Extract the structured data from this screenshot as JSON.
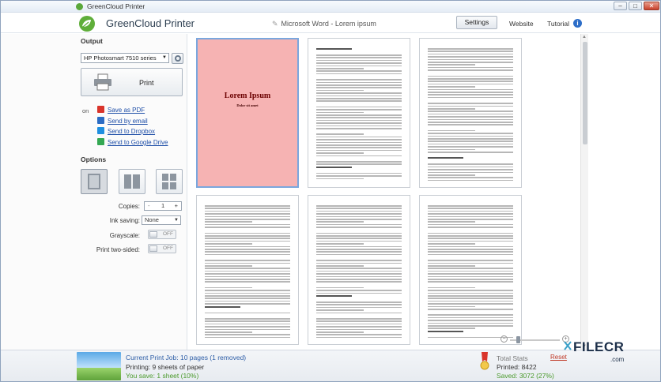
{
  "window": {
    "title": "GreenCloud Printer",
    "minimize_label": "–",
    "maximize_label": "□",
    "close_label": "✕"
  },
  "header": {
    "app_name": "GreenCloud Printer",
    "document_title": "Microsoft Word - Lorem ipsum",
    "settings_label": "Settings",
    "website_label": "Website",
    "tutorial_label": "Tutorial",
    "info_label": "i"
  },
  "sidebar": {
    "output_heading": "Output",
    "printer_selected": "HP Photosmart 7510 series",
    "print_label": "Print",
    "on_label": "on",
    "share": [
      {
        "label": "Save as PDF",
        "icon": "pdf-icon",
        "color": "#d9342b"
      },
      {
        "label": "Send by email",
        "icon": "email-icon",
        "color": "#2b6cc4"
      },
      {
        "label": "Send to Dropbox",
        "icon": "dropbox-icon",
        "color": "#1f8fe0"
      },
      {
        "label": "Send to Google Drive",
        "icon": "google-drive-icon",
        "color": "#34a853"
      }
    ],
    "options_heading": "Options",
    "copies_label": "Copies:",
    "copies_minus": "-",
    "copies_value": "1",
    "copies_plus": "+",
    "ink_saving_label": "Ink saving:",
    "ink_saving_value": "None",
    "grayscale_label": "Grayscale:",
    "grayscale_value": "OFF",
    "two_sided_label": "Print two-sided:",
    "two_sided_value": "OFF"
  },
  "preview": {
    "cover_title": "Lorem Ipsum",
    "cover_subtitle": "Dolor sit amet",
    "zoom_minus": "−",
    "zoom_plus": "+"
  },
  "footer": {
    "job_text": "Current Print Job: 10 pages (1 removed)",
    "printing_text": "Printing: 9 sheets of paper",
    "saved_text": "You save: 1 sheet (10%)",
    "reset_label": "Reset",
    "total_stats_label": "Total Stats",
    "printed_text": "Printed: 8422",
    "saved_total_text": "Saved: 3072 (27%)"
  },
  "watermark": {
    "text": "FILECR",
    "suffix": ".com"
  },
  "colors": {
    "accent": "#2f5fa8",
    "brand_green": "#4a9a2b",
    "cover_page": "#f6b3b3"
  }
}
